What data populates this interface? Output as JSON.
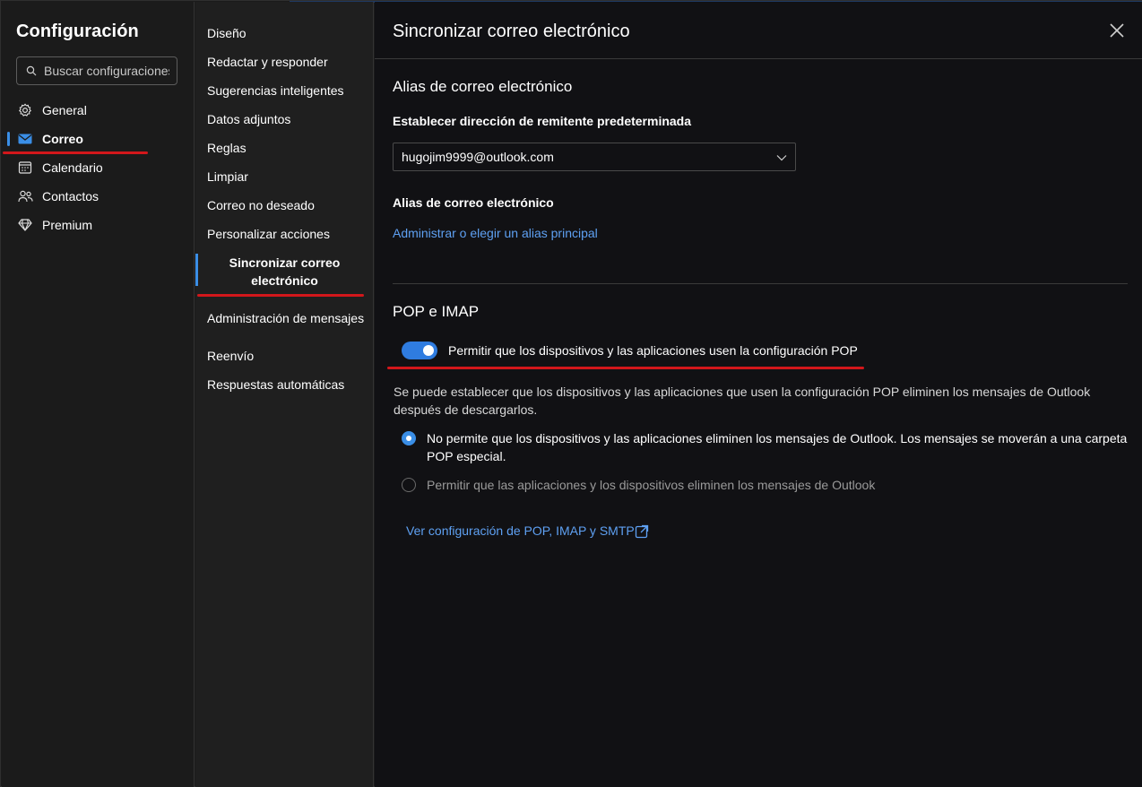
{
  "sidebar": {
    "title": "Configuración",
    "search_placeholder": "Buscar configuraciones",
    "items": [
      {
        "label": "General",
        "icon": "gear-icon"
      },
      {
        "label": "Correo",
        "icon": "mail-icon",
        "active": true
      },
      {
        "label": "Calendario",
        "icon": "calendar-icon"
      },
      {
        "label": "Contactos",
        "icon": "people-icon"
      },
      {
        "label": "Premium",
        "icon": "diamond-icon"
      }
    ]
  },
  "submenu": {
    "items": [
      {
        "label": "Diseño"
      },
      {
        "label": "Redactar y responder"
      },
      {
        "label": "Sugerencias inteligentes"
      },
      {
        "label": "Datos adjuntos"
      },
      {
        "label": "Reglas"
      },
      {
        "label": "Limpiar"
      },
      {
        "label": "Correo no deseado"
      },
      {
        "label": "Personalizar acciones"
      },
      {
        "label_line1": "Sincronizar correo",
        "label_line2": "electrónico",
        "active": true
      },
      {
        "label": "Administración de mensajes"
      },
      {
        "label": "Reenvío"
      },
      {
        "label": "Respuestas automáticas"
      }
    ]
  },
  "pane": {
    "title": "Sincronizar correo electrónico",
    "alias_section": {
      "title": "Alias de correo electrónico",
      "default_sender_label": "Establecer dirección de remitente predeterminada",
      "default_sender_value": "hugojim9999@outlook.com",
      "alias_label": "Alias de correo electrónico",
      "manage_link": "Administrar o elegir un alias principal"
    },
    "pop_section": {
      "title": "POP e IMAP",
      "toggle_label": "Permitir que los dispositivos y las aplicaciones usen la configuración POP",
      "toggle_on": true,
      "description": "Se puede establecer que los dispositivos y las aplicaciones que usen la configuración POP eliminen los mensajes de Outlook después de descargarlos.",
      "option1_line1": "No permite que los dispositivos y las aplicaciones eliminen los mensajes de Outlook. Los mensajes se moverán a una carpeta",
      "option1_line2": "POP especial.",
      "option2": "Permitir que las aplicaciones y los dispositivos eliminen los mensajes de Outlook",
      "settings_link": "Ver configuración de POP, IMAP y SMTP"
    }
  },
  "colors": {
    "accent": "#3a8ee6",
    "link": "#5ea0f2",
    "annotation": "#d2171b"
  }
}
